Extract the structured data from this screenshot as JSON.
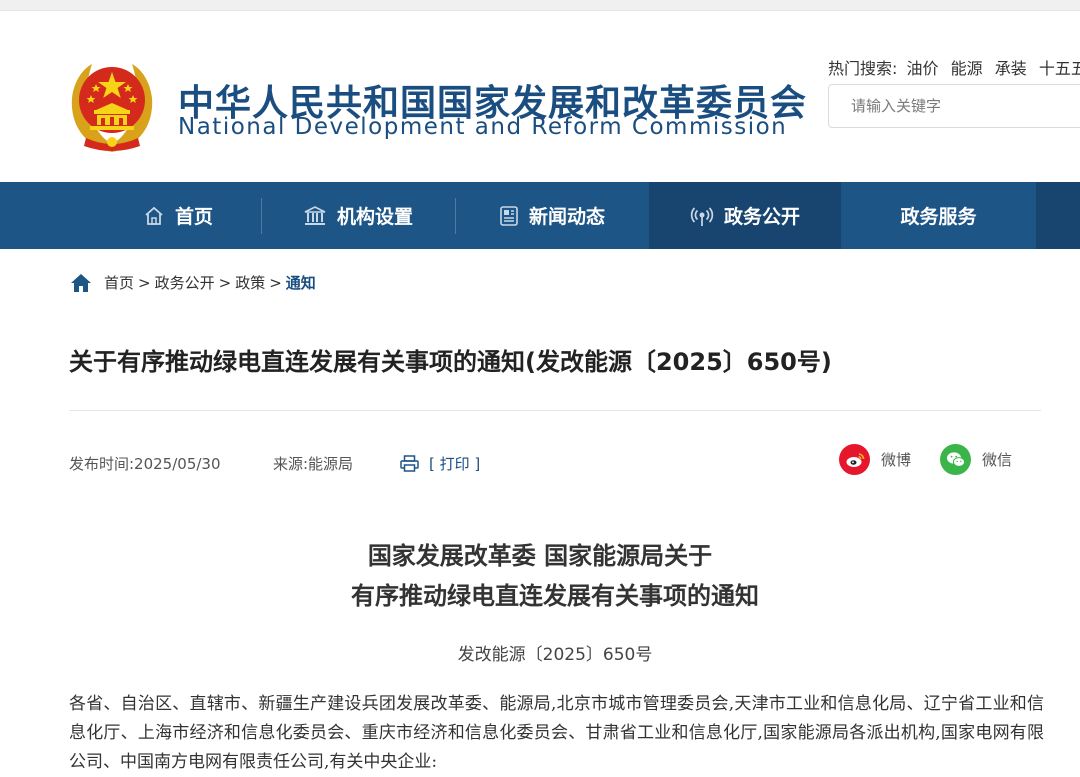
{
  "header": {
    "title_cn": "中华人民共和国国家发展和改革委员会",
    "title_en": "National Development and Reform Commission",
    "hot_label": "热门搜索:",
    "hot_terms": [
      "油价",
      "能源",
      "承装",
      "十五五"
    ],
    "search_placeholder": "请输入关键字"
  },
  "nav": {
    "items": [
      {
        "label": "首页",
        "icon": "home-icon"
      },
      {
        "label": "机构设置",
        "icon": "institution-icon"
      },
      {
        "label": "新闻动态",
        "icon": "news-icon"
      },
      {
        "label": "政务公开",
        "icon": "broadcast-icon",
        "active": true
      },
      {
        "label": "政务服务",
        "icon": ""
      }
    ]
  },
  "breadcrumb": {
    "items": [
      "首页",
      "政务公开",
      "政策"
    ],
    "current": "通知"
  },
  "article": {
    "title": "关于有序推动绿电直连发展有关事项的通知(发改能源〔2025〕650号)",
    "publish_time": "发布时间:2025/05/30",
    "source": "来源:能源局",
    "print_label": "[ 打印 ]",
    "share": {
      "weibo": "微博",
      "wechat": "微信"
    },
    "doc_heading_1": "国家发展改革委 国家能源局关于",
    "doc_heading_2": "有序推动绿电直连发展有关事项的通知",
    "doc_number": "发改能源〔2025〕650号",
    "paragraph": "各省、自治区、直辖市、新疆生产建设兵团发展改革委、能源局,北京市城市管理委员会,天津市工业和信息化局、辽宁省工业和信息化厅、上海市经济和信息化委员会、重庆市经济和信息化委员会、甘肃省工业和信息化厅,国家能源局各派出机构,国家电网有限公司、中国南方电网有限责任公司,有关中央企业:"
  },
  "colors": {
    "brand_blue": "#1d5587",
    "nav_active": "#17456f",
    "weibo_red": "#e6162d",
    "wechat_green": "#3bb54a"
  }
}
